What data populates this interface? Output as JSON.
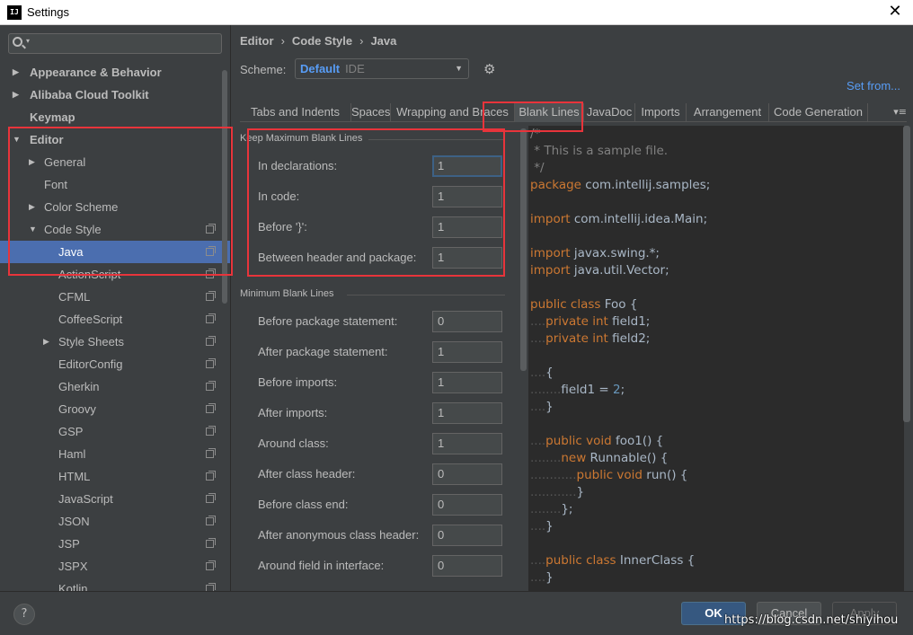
{
  "window": {
    "title": "Settings",
    "app_icon": "IJ"
  },
  "sidebar": {
    "search_placeholder": "",
    "items": [
      {
        "label": "Appearance & Behavior",
        "arrow": "▶"
      },
      {
        "label": "Alibaba Cloud Toolkit",
        "arrow": "▶"
      },
      {
        "label": "Keymap",
        "arrow": ""
      },
      {
        "label": "Editor",
        "arrow": "▼"
      },
      {
        "label": "General",
        "arrow": "▶"
      },
      {
        "label": "Font",
        "arrow": ""
      },
      {
        "label": "Color Scheme",
        "arrow": "▶"
      },
      {
        "label": "Code Style",
        "arrow": "▼"
      },
      {
        "label": "Java",
        "arrow": ""
      },
      {
        "label": "ActionScript",
        "arrow": ""
      },
      {
        "label": "CFML",
        "arrow": ""
      },
      {
        "label": "CoffeeScript",
        "arrow": ""
      },
      {
        "label": "Style Sheets",
        "arrow": "▶"
      },
      {
        "label": "EditorConfig",
        "arrow": ""
      },
      {
        "label": "Gherkin",
        "arrow": ""
      },
      {
        "label": "Groovy",
        "arrow": ""
      },
      {
        "label": "GSP",
        "arrow": ""
      },
      {
        "label": "Haml",
        "arrow": ""
      },
      {
        "label": "HTML",
        "arrow": ""
      },
      {
        "label": "JavaScript",
        "arrow": ""
      },
      {
        "label": "JSON",
        "arrow": ""
      },
      {
        "label": "JSP",
        "arrow": ""
      },
      {
        "label": "JSPX",
        "arrow": ""
      },
      {
        "label": "Kotlin",
        "arrow": ""
      }
    ]
  },
  "breadcrumb": {
    "part1": "Editor",
    "part2": "Code Style",
    "part3": "Java",
    "separator": "›"
  },
  "scheme": {
    "label": "Scheme:",
    "value": "Default",
    "kind": "IDE",
    "set_from": "Set from..."
  },
  "tabs": [
    "Tabs and Indents",
    "Spaces",
    "Wrapping and Braces",
    "Blank Lines",
    "JavaDoc",
    "Imports",
    "Arrangement",
    "Code Generation"
  ],
  "tab_more": "▾≡",
  "keep_max": {
    "title": "Keep Maximum Blank Lines",
    "rows": [
      {
        "label": "In declarations:",
        "value": "1"
      },
      {
        "label": "In code:",
        "value": "1"
      },
      {
        "label": "Before '}':",
        "value": "1"
      },
      {
        "label": "Between header and package:",
        "value": "1"
      }
    ]
  },
  "min_blank": {
    "title": "Minimum Blank Lines",
    "rows": [
      {
        "label": "Before package statement:",
        "value": "0"
      },
      {
        "label": "After package statement:",
        "value": "1"
      },
      {
        "label": "Before imports:",
        "value": "1"
      },
      {
        "label": "After imports:",
        "value": "1"
      },
      {
        "label": "Around class:",
        "value": "1"
      },
      {
        "label": "After class header:",
        "value": "0"
      },
      {
        "label": "Before class end:",
        "value": "0"
      },
      {
        "label": "After anonymous class header:",
        "value": "0"
      },
      {
        "label": "Around field in interface:",
        "value": "0"
      }
    ]
  },
  "code_lines": [
    [
      [
        "c",
        "/*"
      ]
    ],
    [
      [
        "c",
        " * This is a sample file."
      ]
    ],
    [
      [
        "c",
        " */"
      ]
    ],
    [
      [
        "k",
        "package "
      ],
      [
        "n",
        "com.intellij.samples;"
      ]
    ],
    [],
    [
      [
        "k",
        "import "
      ],
      [
        "n",
        "com.intellij.idea.Main;"
      ]
    ],
    [],
    [
      [
        "k",
        "import "
      ],
      [
        "n",
        "javax.swing.*;"
      ]
    ],
    [
      [
        "k",
        "import "
      ],
      [
        "n",
        "java.util.Vector;"
      ]
    ],
    [],
    [
      [
        "k",
        "public class "
      ],
      [
        "n",
        "Foo {"
      ]
    ],
    [
      [
        "dots",
        "...."
      ],
      [
        "k",
        "private int "
      ],
      [
        "n",
        "field1;"
      ]
    ],
    [
      [
        "dots",
        "...."
      ],
      [
        "k",
        "private int "
      ],
      [
        "n",
        "field2;"
      ]
    ],
    [],
    [
      [
        "dots",
        "...."
      ],
      [
        "n",
        "{"
      ]
    ],
    [
      [
        "dots",
        "........"
      ],
      [
        "n",
        "field1 = "
      ],
      [
        "num",
        "2"
      ],
      [
        "n",
        ";"
      ]
    ],
    [
      [
        "dots",
        "...."
      ],
      [
        "n",
        "}"
      ]
    ],
    [],
    [
      [
        "dots",
        "...."
      ],
      [
        "k",
        "public void "
      ],
      [
        "n",
        "foo1() {"
      ]
    ],
    [
      [
        "dots",
        "........"
      ],
      [
        "k",
        "new "
      ],
      [
        "n",
        "Runnable() {"
      ]
    ],
    [
      [
        "dots",
        "............"
      ],
      [
        "k",
        "public void "
      ],
      [
        "n",
        "run() {"
      ]
    ],
    [
      [
        "dots",
        "............"
      ],
      [
        "n",
        "}"
      ]
    ],
    [
      [
        "dots",
        "........"
      ],
      [
        "n",
        "};"
      ]
    ],
    [
      [
        "dots",
        "...."
      ],
      [
        "n",
        "}"
      ]
    ],
    [],
    [
      [
        "dots",
        "...."
      ],
      [
        "k",
        "public class "
      ],
      [
        "n",
        "InnerClass {"
      ]
    ],
    [
      [
        "dots",
        "...."
      ],
      [
        "n",
        "}"
      ]
    ]
  ],
  "buttons": {
    "help": "?",
    "ok": "OK",
    "cancel": "Cancel",
    "apply": "Apply"
  },
  "watermark": "https://blog.csdn.net/shiyihou",
  "colors": {
    "background": "#3c3f41",
    "selection": "#4b6eaf",
    "keyword": "#cc7832",
    "text": "#a9b7c6",
    "comment": "#808080",
    "number": "#6897bb",
    "link": "#589df6",
    "annotation": "#e8343b"
  }
}
